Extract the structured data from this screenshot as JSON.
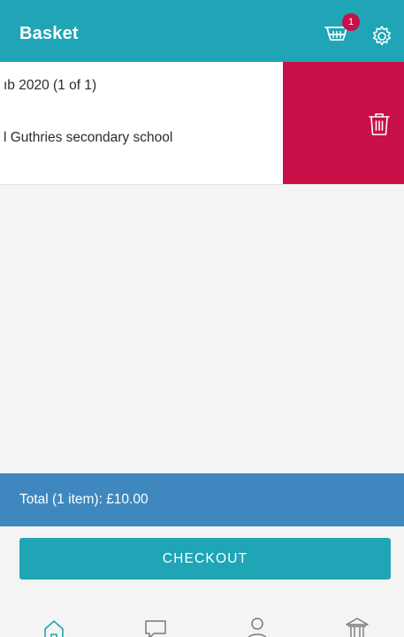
{
  "header": {
    "title": "Basket",
    "cart_badge_count": "1",
    "icons": [
      "basket-icon",
      "settings-icon"
    ]
  },
  "basket_item": {
    "name_line": "ıb 2020 (1 of 1)",
    "school_line": "l Guthries secondary school",
    "delete_icon": "trash-icon"
  },
  "summary": {
    "total_text": "Total (1 item): £10.00"
  },
  "actions": {
    "checkout_label": "CHECKOUT"
  },
  "bottom_nav": {
    "icons": [
      "home-icon",
      "messages-icon",
      "profile-icon",
      "school-icon"
    ]
  },
  "colors": {
    "primary": "#1fa5b5",
    "delete": "#c80f47",
    "total_bar": "#3f88bf",
    "background": "#f4f4f4"
  }
}
